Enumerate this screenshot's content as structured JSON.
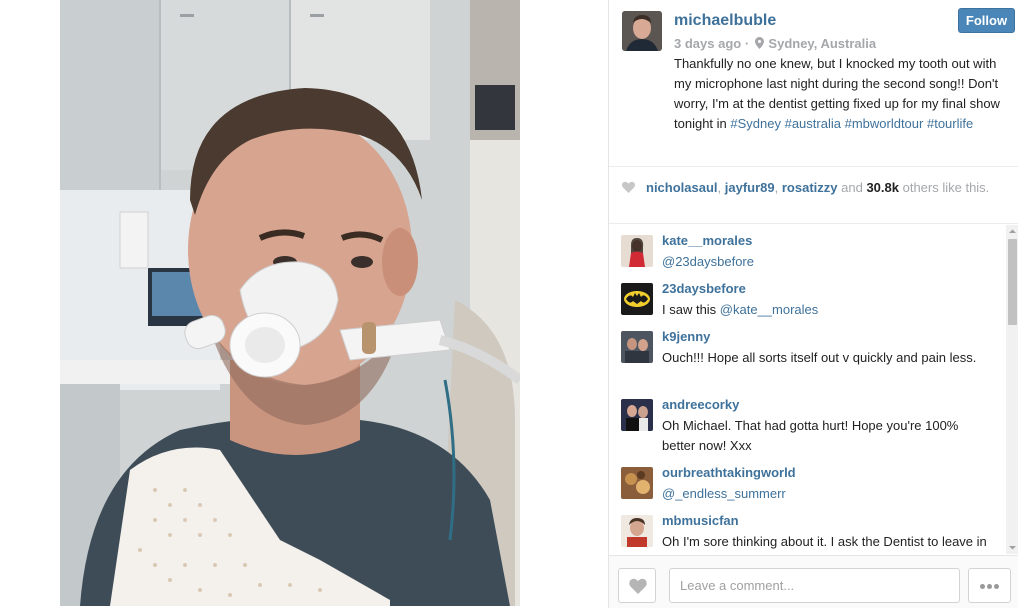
{
  "post": {
    "username": "michaelbuble",
    "time_ago": "3 days ago",
    "location": "Sydney, Australia",
    "follow_label": "Follow",
    "caption_parts": [
      "Thankfully no one knew, but I knocked my tooth out with my microphone last night during the second song!! Don't worry, I'm at the dentist getting fixed up for my final show tonight in ",
      "#Sydney",
      " ",
      "#australia",
      " ",
      "#mbworldtour",
      " ",
      "#tourlife"
    ]
  },
  "likes": {
    "users": [
      "nicholasaul",
      "jayfur89",
      "rosatizzy"
    ],
    "count": "30.8k",
    "sep1": ", ",
    "sep2": ", ",
    "and_text": " and ",
    "suffix": " others like this."
  },
  "comments": [
    {
      "user": "kate__morales",
      "mention": "@23daysbefore",
      "text": ""
    },
    {
      "user": "23daysbefore",
      "text": "I saw this ",
      "mention": "@kate__morales"
    },
    {
      "user": "k9jenny",
      "text": "Ouch!!! Hope all sorts itself out v quickly and pain less."
    },
    {
      "user": "andreecorky",
      "text": "Oh Michael. That had gotta hurt! Hope you're 100% better now! Xxx"
    },
    {
      "user": "ourbreathtakingworld",
      "mention": "@_endless_summerr",
      "text": ""
    },
    {
      "user": "mbmusicfan",
      "text": "Oh I'm sore thinking about it. I ask the Dentist to leave in a tooth so if he ever had an issue on stage the show"
    }
  ],
  "footer": {
    "comment_placeholder": "Leave a comment..."
  },
  "colors": {
    "link": "#3f729b",
    "follow_button": "#4b86b8",
    "muted": "#a5a7aa"
  },
  "icons": [
    "location-pin-icon",
    "heart-icon",
    "scroll-up-icon",
    "scroll-down-icon",
    "more-options-icon"
  ]
}
